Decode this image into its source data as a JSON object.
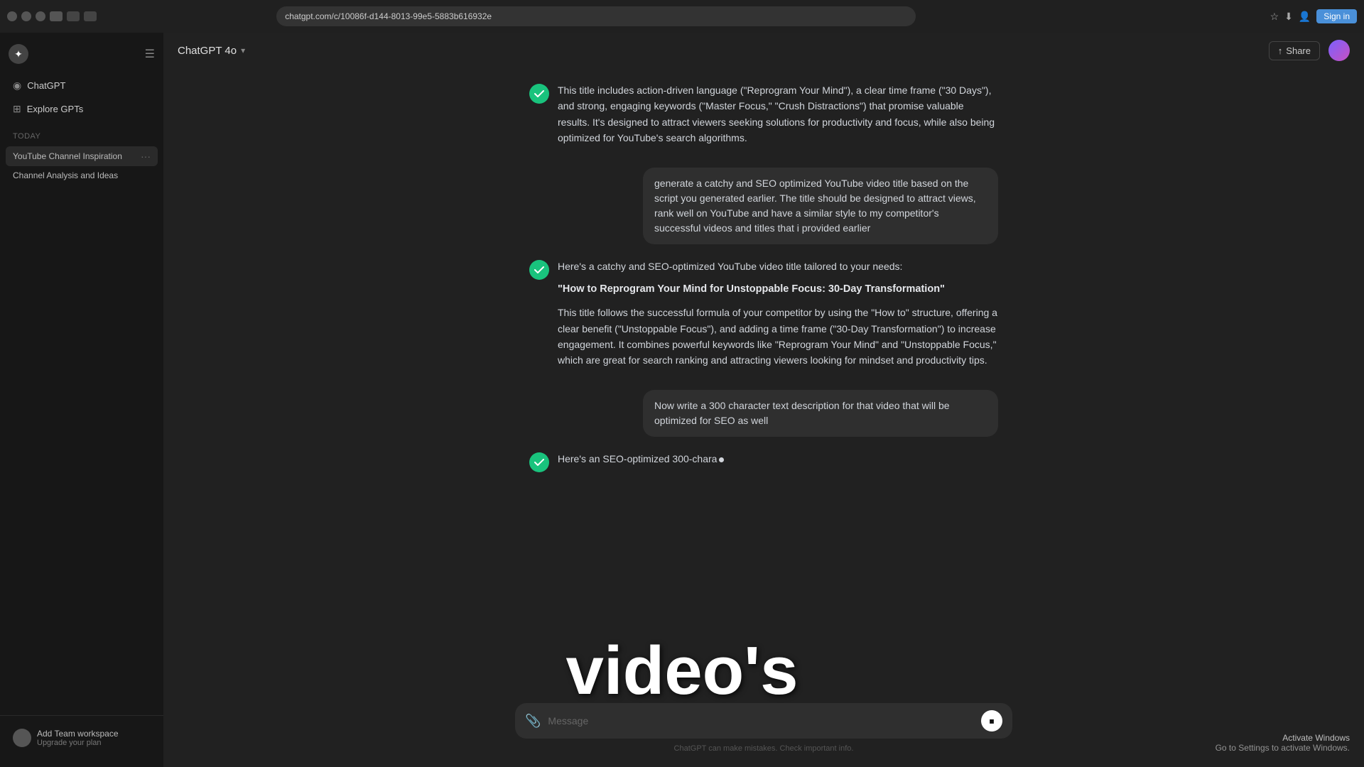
{
  "browser": {
    "url": "chatgpt.com/c/10086f-d144-8013-99e5-5883b616932e",
    "profile_btn": "Sign in"
  },
  "model": {
    "name": "ChatGPT 4o",
    "chevron": "▾"
  },
  "topbar": {
    "share_label": "Share"
  },
  "sidebar": {
    "logo_icon": "◎",
    "nav_items": [
      {
        "label": "ChatGPT",
        "icon": "◉"
      },
      {
        "label": "Explore GPTs",
        "icon": "⊞"
      }
    ],
    "section_label": "Today",
    "history_items": [
      {
        "label": "YouTube Channel Inspiration",
        "active": true
      },
      {
        "label": "Channel Analysis and Ideas",
        "active": false
      }
    ],
    "user_label": "Add Team workspace",
    "user_sub": "Upgrade your plan"
  },
  "chat": {
    "assistant_intro": "This title includes action-driven language (\"Reprogram Your Mind\"), a clear time frame (\"30 Days\"), and strong, engaging keywords (\"Master Focus,\" \"Crush Distractions\") that promise valuable results. It's designed to attract viewers seeking solutions for productivity and focus, while also being optimized for YouTube's search algorithms.",
    "user_message_1": "generate a catchy and SEO optimized YouTube video title based on the script you generated earlier. The title should be designed to attract views, rank well on YouTube and have a similar style to my competitor's successful videos and titles that i provided earlier",
    "assistant_response_intro": "Here's a catchy and SEO-optimized YouTube video title tailored to your needs:",
    "video_title": "\"How to Reprogram Your Mind for Unstoppable Focus: 30-Day Transformation\"",
    "assistant_response_body": "This title follows the successful formula of your competitor by using the \"How to\" structure, offering a clear benefit (\"Unstoppable Focus\"), and adding a time frame (\"30-Day Transformation\") to increase engagement. It combines powerful keywords like \"Reprogram Your Mind\" and \"Unstoppable Focus,\" which are great for search ranking and attracting viewers looking for mindset and productivity tips.",
    "user_message_2": "Now write a 300 character text description for that video that will be optimized for SEO as well",
    "assistant_typing": "Here's an SEO-optimized 300-chara",
    "placeholder": "Message",
    "disclaimer": "ChatGPT can make mistakes. Check important info."
  },
  "overlay": {
    "text": "video's"
  },
  "windows": {
    "title": "Activate Windows",
    "subtitle": "Go to Settings to activate Windows."
  },
  "icons": {
    "attach": "📎",
    "share": "↑",
    "send": "▶"
  }
}
